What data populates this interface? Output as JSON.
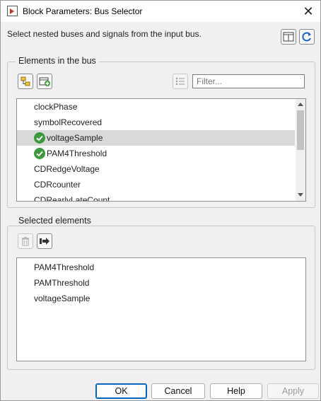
{
  "window": {
    "title": "Block Parameters: Bus Selector"
  },
  "description": "Select nested buses and signals from the input bus.",
  "elements_group": {
    "legend": "Elements in the bus",
    "filter_placeholder": "Filter...",
    "items": [
      {
        "label": "clockPhase",
        "checked": false,
        "selected": false
      },
      {
        "label": "symbolRecovered",
        "checked": false,
        "selected": false
      },
      {
        "label": "voltageSample",
        "checked": true,
        "selected": true
      },
      {
        "label": "PAM4Threshold",
        "checked": true,
        "selected": false
      },
      {
        "label": "CDRedgeVoltage",
        "checked": false,
        "selected": false
      },
      {
        "label": "CDRcounter",
        "checked": false,
        "selected": false
      },
      {
        "label": "CDRearlyLateCount",
        "checked": false,
        "selected": false
      }
    ]
  },
  "selected_group": {
    "legend": "Selected elements",
    "items": [
      {
        "label": "PAM4Threshold"
      },
      {
        "label": "PAMThreshold"
      },
      {
        "label": "voltageSample"
      }
    ]
  },
  "buttons": {
    "ok": "OK",
    "cancel": "Cancel",
    "help": "Help",
    "apply": "Apply"
  },
  "colors": {
    "check_green": "#3c9a3c",
    "selection_gray": "#d9d9d9",
    "primary_border": "#0067c0"
  }
}
